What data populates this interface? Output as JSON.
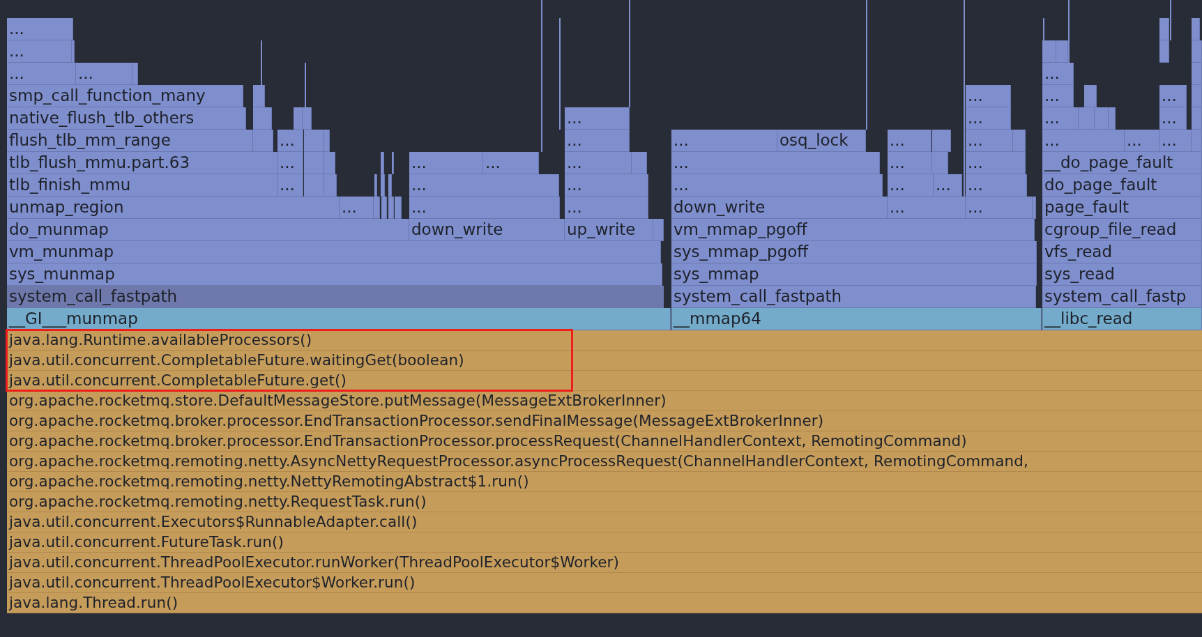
{
  "flame_graph": {
    "frames": [
      {
        "label": "...",
        "kind": "kernel",
        "selected": false
      },
      {
        "label": "...",
        "kind": "kernel",
        "selected": false
      },
      {
        "label": "...",
        "kind": "kernel",
        "selected": false
      },
      {
        "label": "...",
        "kind": "kernel",
        "selected": false
      },
      {
        "label": "...",
        "kind": "kernel",
        "selected": false
      },
      {
        "label": "smp_call_function_many",
        "kind": "kernel",
        "selected": false
      },
      {
        "label": "...",
        "kind": "kernel",
        "selected": false
      },
      {
        "label": "...",
        "kind": "kernel",
        "selected": false
      },
      {
        "label": "...",
        "kind": "kernel",
        "selected": false
      },
      {
        "label": "native_flush_tlb_others",
        "kind": "kernel",
        "selected": false
      },
      {
        "label": "...",
        "kind": "kernel",
        "selected": false
      },
      {
        "label": "...",
        "kind": "kernel",
        "selected": false
      },
      {
        "label": "...",
        "kind": "kernel",
        "selected": false
      },
      {
        "label": "...",
        "kind": "kernel",
        "selected": false
      },
      {
        "label": "flush_tlb_mm_range",
        "kind": "kernel",
        "selected": false
      },
      {
        "label": "...",
        "kind": "kernel",
        "selected": false
      },
      {
        "label": "...",
        "kind": "kernel",
        "selected": false
      },
      {
        "label": "...",
        "kind": "kernel",
        "selected": false
      },
      {
        "label": "osq_lock",
        "kind": "kernel",
        "selected": false
      },
      {
        "label": "...",
        "kind": "kernel",
        "selected": false
      },
      {
        "label": "...",
        "kind": "kernel",
        "selected": false
      },
      {
        "label": "...",
        "kind": "kernel",
        "selected": false
      },
      {
        "label": "...",
        "kind": "kernel",
        "selected": false
      },
      {
        "label": "...",
        "kind": "kernel",
        "selected": false
      },
      {
        "label": "tlb_flush_mmu.part.63",
        "kind": "kernel",
        "selected": false
      },
      {
        "label": "...",
        "kind": "kernel",
        "selected": false
      },
      {
        "label": "...",
        "kind": "kernel",
        "selected": false
      },
      {
        "label": "...",
        "kind": "kernel",
        "selected": false
      },
      {
        "label": "...",
        "kind": "kernel",
        "selected": false
      },
      {
        "label": "...",
        "kind": "kernel",
        "selected": false
      },
      {
        "label": "...",
        "kind": "kernel",
        "selected": false
      },
      {
        "label": "...",
        "kind": "kernel",
        "selected": false
      },
      {
        "label": "__do_page_fault",
        "kind": "kernel",
        "selected": false
      },
      {
        "label": "tlb_finish_mmu",
        "kind": "kernel",
        "selected": false
      },
      {
        "label": "...",
        "kind": "kernel",
        "selected": false
      },
      {
        "label": "...",
        "kind": "kernel",
        "selected": false
      },
      {
        "label": "...",
        "kind": "kernel",
        "selected": false
      },
      {
        "label": "...",
        "kind": "kernel",
        "selected": false
      },
      {
        "label": "...",
        "kind": "kernel",
        "selected": false
      },
      {
        "label": "...",
        "kind": "kernel",
        "selected": false
      },
      {
        "label": "...",
        "kind": "kernel",
        "selected": false
      },
      {
        "label": "do_page_fault",
        "kind": "kernel",
        "selected": false
      },
      {
        "label": "unmap_region",
        "kind": "kernel",
        "selected": false
      },
      {
        "label": "...",
        "kind": "kernel",
        "selected": false
      },
      {
        "label": "...",
        "kind": "kernel",
        "selected": false
      },
      {
        "label": "...",
        "kind": "kernel",
        "selected": false
      },
      {
        "label": "down_write",
        "kind": "kernel",
        "selected": false
      },
      {
        "label": "...",
        "kind": "kernel",
        "selected": false
      },
      {
        "label": "...",
        "kind": "kernel",
        "selected": false
      },
      {
        "label": "page_fault",
        "kind": "kernel",
        "selected": false
      },
      {
        "label": "do_munmap",
        "kind": "kernel",
        "selected": false
      },
      {
        "label": "down_write",
        "kind": "kernel",
        "selected": false
      },
      {
        "label": "up_write",
        "kind": "kernel",
        "selected": false
      },
      {
        "label": "vm_mmap_pgoff",
        "kind": "kernel",
        "selected": false
      },
      {
        "label": "cgroup_file_read",
        "kind": "kernel",
        "selected": false
      },
      {
        "label": "vm_munmap",
        "kind": "kernel",
        "selected": false
      },
      {
        "label": "sys_mmap_pgoff",
        "kind": "kernel",
        "selected": false
      },
      {
        "label": "vfs_read",
        "kind": "kernel",
        "selected": false
      },
      {
        "label": "sys_munmap",
        "kind": "kernel",
        "selected": false
      },
      {
        "label": "sys_mmap",
        "kind": "kernel",
        "selected": false
      },
      {
        "label": "sys_read",
        "kind": "kernel",
        "selected": false
      },
      {
        "label": "system_call_fastpath",
        "kind": "kernel",
        "selected": true
      },
      {
        "label": "system_call_fastpath",
        "kind": "kernel",
        "selected": false
      },
      {
        "label": "system_call_fastp",
        "kind": "kernel",
        "selected": false
      },
      {
        "label": "__GI___munmap",
        "kind": "native",
        "selected": false
      },
      {
        "label": "__mmap64",
        "kind": "native",
        "selected": false
      },
      {
        "label": "__libc_read",
        "kind": "native",
        "selected": false
      }
    ],
    "java_frames": [
      {
        "label": "java.lang.Runtime.availableProcessors()",
        "highlighted": true
      },
      {
        "label": "java.util.concurrent.CompletableFuture.waitingGet(boolean)",
        "highlighted": true
      },
      {
        "label": "java.util.concurrent.CompletableFuture.get()",
        "highlighted": true
      },
      {
        "label": "org.apache.rocketmq.store.DefaultMessageStore.putMessage(MessageExtBrokerInner)",
        "highlighted": false
      },
      {
        "label": "org.apache.rocketmq.broker.processor.EndTransactionProcessor.sendFinalMessage(MessageExtBrokerInner)",
        "highlighted": false
      },
      {
        "label": "org.apache.rocketmq.broker.processor.EndTransactionProcessor.processRequest(ChannelHandlerContext, RemotingCommand)",
        "highlighted": false
      },
      {
        "label": "org.apache.rocketmq.remoting.netty.AsyncNettyRequestProcessor.asyncProcessRequest(ChannelHandlerContext, RemotingCommand,",
        "highlighted": false
      },
      {
        "label": "org.apache.rocketmq.remoting.netty.NettyRemotingAbstract$1.run()",
        "highlighted": false
      },
      {
        "label": "org.apache.rocketmq.remoting.netty.RequestTask.run()",
        "highlighted": false
      },
      {
        "label": "java.util.concurrent.Executors$RunnableAdapter.call()",
        "highlighted": false
      },
      {
        "label": "java.util.concurrent.FutureTask.run()",
        "highlighted": false
      },
      {
        "label": "java.util.concurrent.ThreadPoolExecutor.runWorker(ThreadPoolExecutor$Worker)",
        "highlighted": false
      },
      {
        "label": "java.util.concurrent.ThreadPoolExecutor$Worker.run()",
        "highlighted": false
      },
      {
        "label": "java.lang.Thread.run()",
        "highlighted": false
      }
    ]
  }
}
